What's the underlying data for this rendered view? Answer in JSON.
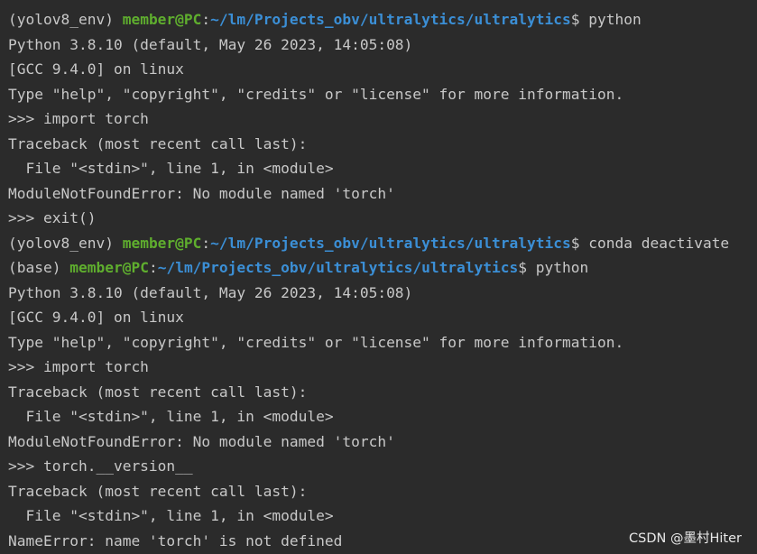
{
  "terminal": {
    "prompts": [
      {
        "env": "(yolov8_env) ",
        "user": "member@PC",
        "colon": ":",
        "path": "~/lm/Projects_obv/ultralytics/ultralytics",
        "symbol": "$ ",
        "command": "python"
      },
      {
        "env": "(yolov8_env) ",
        "user": "member@PC",
        "colon": ":",
        "path": "~/lm/Projects_obv/ultralytics/ultralytics",
        "symbol": "$ ",
        "command": "conda deactivate"
      },
      {
        "env": "(base) ",
        "user": "member@PC",
        "colon": ":",
        "path": "~/lm/Projects_obv/ultralytics/ultralytics",
        "symbol": "$ ",
        "command": "python"
      }
    ],
    "block1": [
      "Python 3.8.10 (default, May 26 2023, 14:05:08)",
      "[GCC 9.4.0] on linux",
      "Type \"help\", \"copyright\", \"credits\" or \"license\" for more information.",
      ">>> import torch",
      "Traceback (most recent call last):",
      "  File \"<stdin>\", line 1, in <module>",
      "ModuleNotFoundError: No module named 'torch'",
      ">>> exit()"
    ],
    "block2": [
      "Python 3.8.10 (default, May 26 2023, 14:05:08)",
      "[GCC 9.4.0] on linux",
      "Type \"help\", \"copyright\", \"credits\" or \"license\" for more information.",
      ">>> import torch",
      "Traceback (most recent call last):",
      "  File \"<stdin>\", line 1, in <module>",
      "ModuleNotFoundError: No module named 'torch'",
      ">>> torch.__version__",
      "Traceback (most recent call last):",
      "  File \"<stdin>\", line 1, in <module>",
      "NameError: name 'torch' is not defined"
    ]
  },
  "watermark": "CSDN @墨村Hiter",
  "colors": {
    "background": "#2b2b2b",
    "text": "#c8c8c8",
    "user": "#5fae2e",
    "path": "#3b8fd6"
  }
}
